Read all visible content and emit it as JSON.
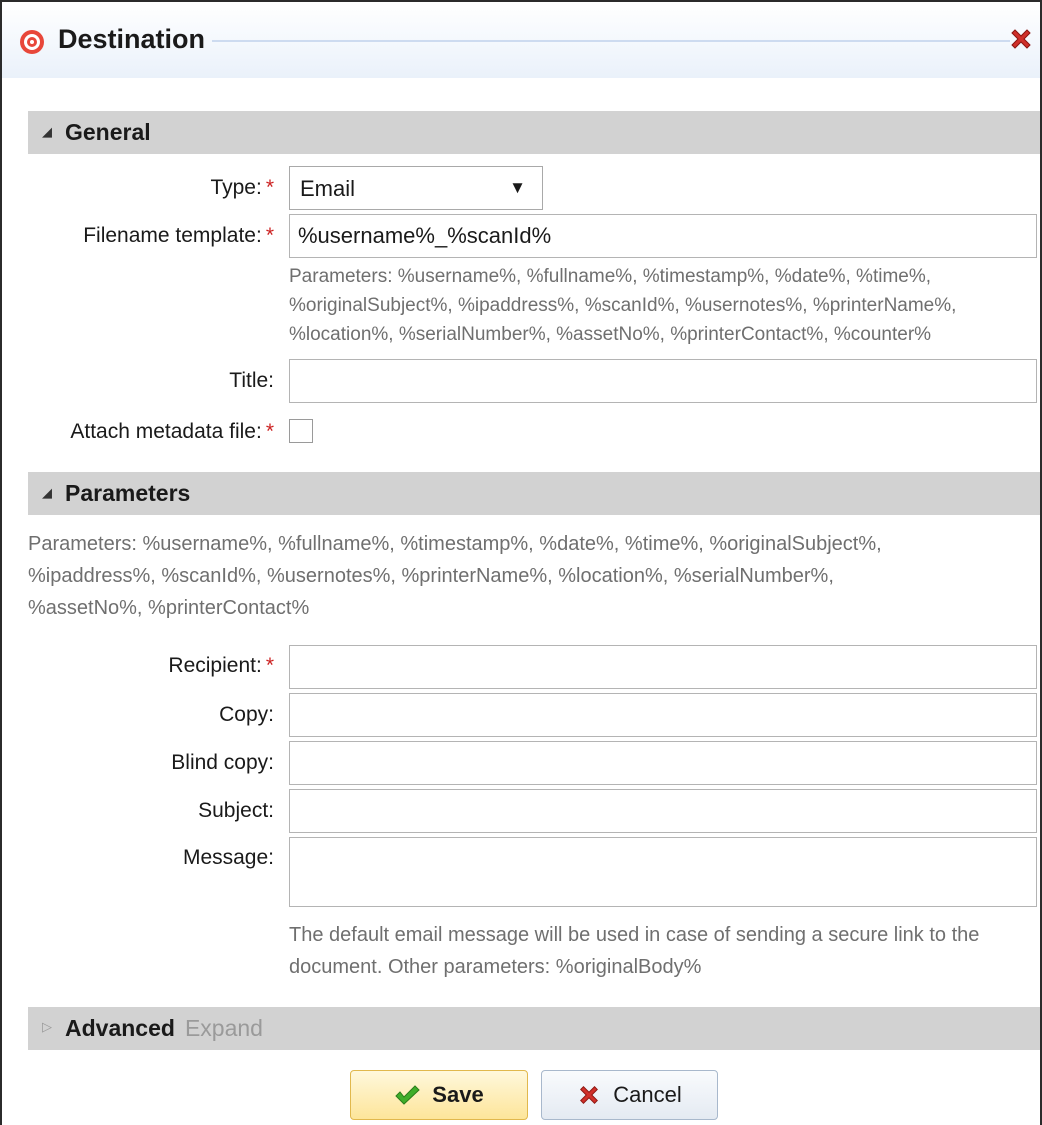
{
  "dialog": {
    "title": "Destination",
    "close_icon": "close-icon"
  },
  "sections": {
    "general": {
      "title": "General"
    },
    "parameters": {
      "title": "Parameters"
    },
    "advanced": {
      "title": "Advanced",
      "toggle": "Expand"
    }
  },
  "general": {
    "type_label": "Type:",
    "type_value": "Email",
    "filename_label": "Filename template:",
    "filename_value": "%username%_%scanId%",
    "filename_help_1": "Parameters: %username%, %fullname%, %timestamp%, %date%, %time%,",
    "filename_help_2": "%originalSubject%, %ipaddress%, %scanId%, %usernotes%, %printerName%,",
    "filename_help_3": "%location%, %serialNumber%, %assetNo%, %printerContact%, %counter%",
    "title_label": "Title:",
    "title_value": "",
    "metadata_label": "Attach metadata file:",
    "metadata_checked": false,
    "required_mark": "*"
  },
  "parameters": {
    "help_1": "Parameters: %username%, %fullname%, %timestamp%, %date%, %time%, %originalSubject%,",
    "help_2": "%ipaddress%, %scanId%, %usernotes%, %printerName%, %location%, %serialNumber%,",
    "help_3": "%assetNo%, %printerContact%",
    "recipient_label": "Recipient:",
    "copy_label": "Copy:",
    "blind_copy_label": "Blind copy:",
    "subject_label": "Subject:",
    "message_label": "Message:",
    "message_help_1": "The default email message will be used in case of sending a secure link to the",
    "message_help_2": "document. Other parameters: %originalBody%"
  },
  "buttons": {
    "save": "Save",
    "cancel": "Cancel"
  },
  "colors": {
    "required": "#cc2222",
    "section_bg": "#d2d2d2",
    "save_bg": "#fde59a"
  }
}
